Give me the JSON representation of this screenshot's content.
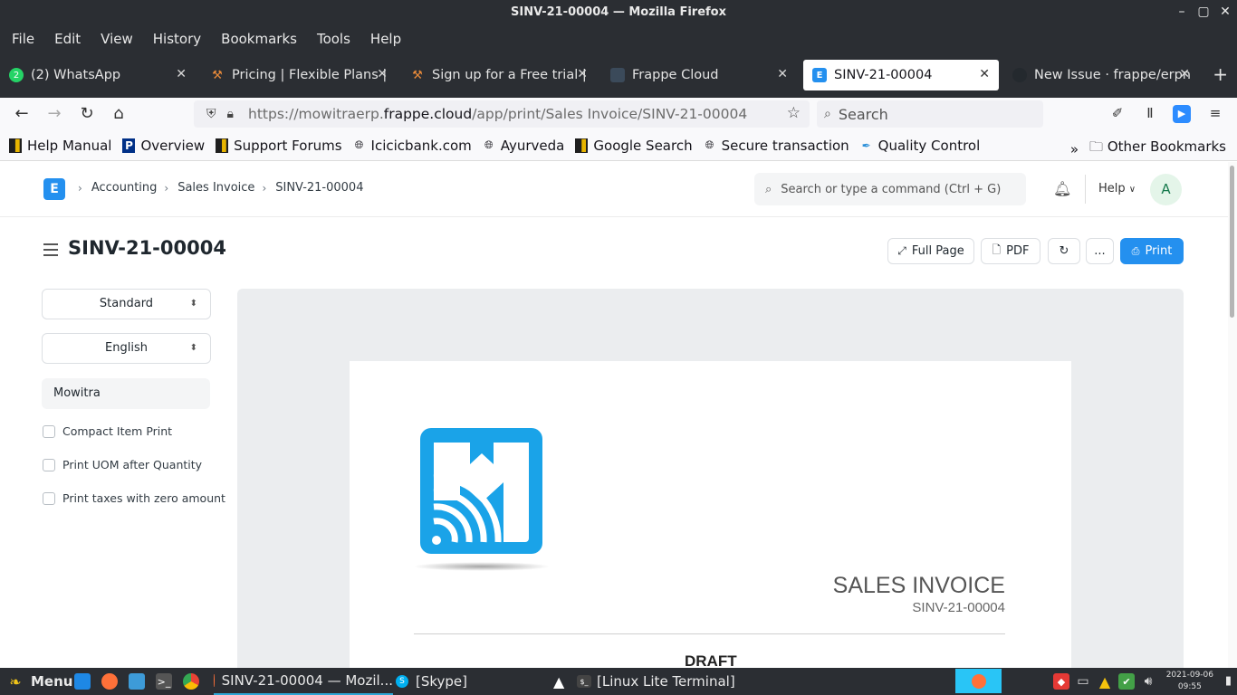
{
  "window": {
    "title": "SINV-21-00004 — Mozilla Firefox"
  },
  "menubar": [
    "File",
    "Edit",
    "View",
    "History",
    "Bookmarks",
    "Tools",
    "Help"
  ],
  "tabs": [
    {
      "label": "(2) WhatsApp",
      "icon": "whatsapp-icon",
      "badge": "2"
    },
    {
      "label": "Pricing | Flexible Plans |",
      "icon": "hammer-icon"
    },
    {
      "label": "Sign up for a Free trial |",
      "icon": "hammer-icon"
    },
    {
      "label": "Frappe Cloud",
      "icon": "frappe-icon"
    },
    {
      "label": "SINV-21-00004",
      "icon": "erpnext-icon",
      "active": true
    },
    {
      "label": "New Issue · frappe/erpn",
      "icon": "github-icon"
    }
  ],
  "nav": {
    "url_prefix": "https://mowitraerp.",
    "url_domain": "frappe.cloud",
    "url_path": "/app/print/Sales Invoice/SINV-21-00004",
    "search_placeholder": "Search"
  },
  "bookmarks": [
    {
      "label": "Help Manual",
      "icon": "bookmark-doc-icon"
    },
    {
      "label": "Overview",
      "icon": "paypal-icon"
    },
    {
      "label": "Support Forums",
      "icon": "bookmark-doc-icon"
    },
    {
      "label": "Icicicbank.com",
      "icon": "globe-icon"
    },
    {
      "label": "Ayurveda",
      "icon": "globe-icon"
    },
    {
      "label": "Google Search",
      "icon": "bookmark-doc-icon"
    },
    {
      "label": "Secure transaction",
      "icon": "globe-icon"
    },
    {
      "label": "Quality Control",
      "icon": "feather-icon"
    }
  ],
  "bookmarks_other": "Other Bookmarks",
  "app": {
    "logo_letter": "E",
    "breadcrumbs": [
      "Accounting",
      "Sales Invoice",
      "SINV-21-00004"
    ],
    "search_placeholder": "Search or type a command (Ctrl + G)",
    "help_label": "Help",
    "avatar_letter": "A"
  },
  "page": {
    "title": "SINV-21-00004",
    "buttons": {
      "full_page": "Full Page",
      "pdf": "PDF",
      "more": "...",
      "print": "Print"
    }
  },
  "sidebar": {
    "print_format": "Standard",
    "language": "English",
    "letterhead": "Mowitra",
    "checkboxes": [
      "Compact Item Print",
      "Print UOM after Quantity",
      "Print taxes with zero amount"
    ]
  },
  "invoice": {
    "heading": "SALES INVOICE",
    "number": "SINV-21-00004",
    "status": "DRAFT",
    "logo_color": "#1aa3e8"
  },
  "taskbar": {
    "menu_label": "Menu",
    "windows": [
      {
        "label": "SINV-21-00004 — Mozil...",
        "icon": "firefox-icon",
        "active": true
      },
      {
        "label": "[Skype]",
        "icon": "skype-icon"
      },
      {
        "label": "[Linux Lite Terminal]",
        "icon": "terminal-icon"
      }
    ],
    "date": "2021-09-06",
    "time": "09:55"
  },
  "colors": {
    "primary": "#2490ef",
    "chrome": "#2b2e33"
  }
}
